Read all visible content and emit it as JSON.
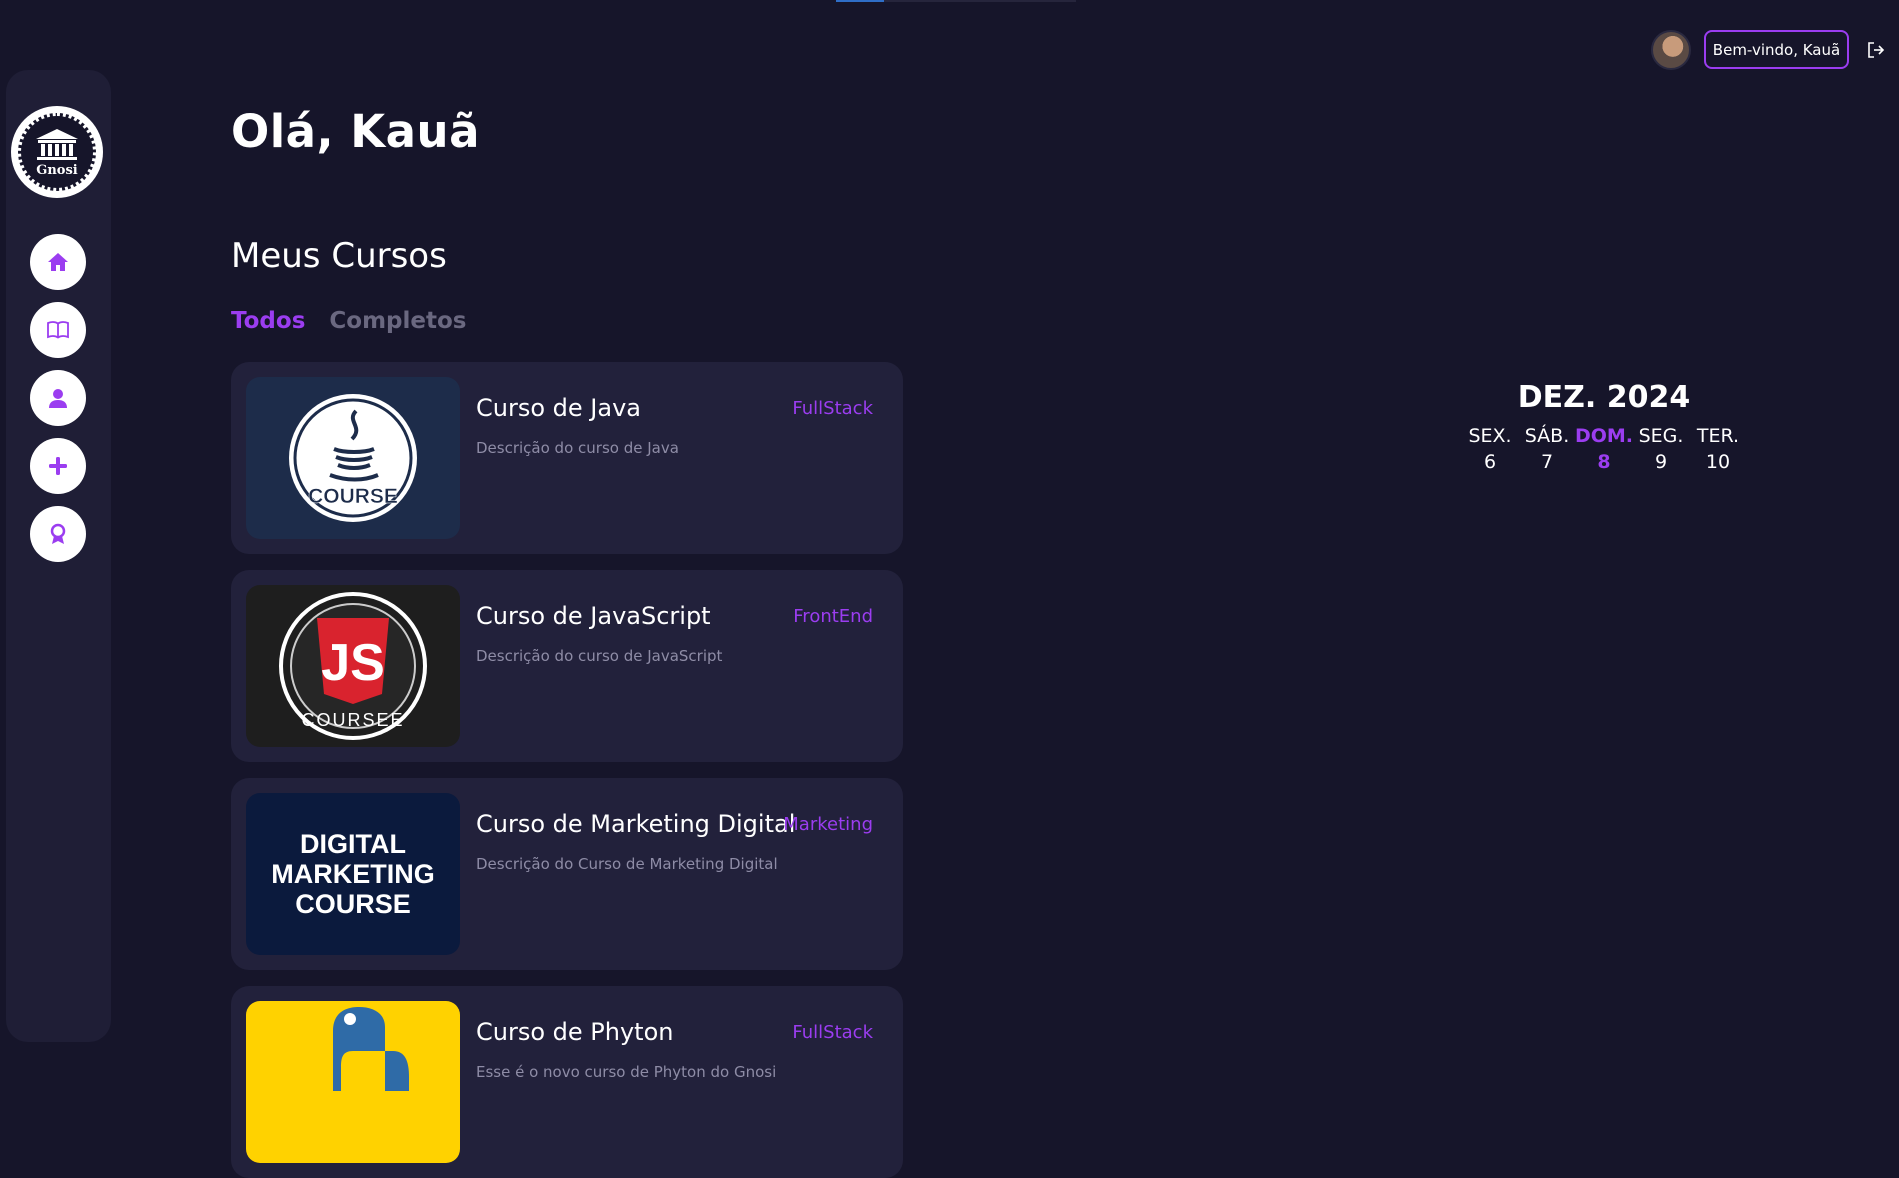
{
  "header": {
    "welcome_label": "Bem-vindo, Kauã"
  },
  "sidebar": {
    "brand": "Gnosi",
    "items": [
      {
        "name": "home"
      },
      {
        "name": "courses"
      },
      {
        "name": "profile"
      },
      {
        "name": "add"
      },
      {
        "name": "certificates"
      }
    ]
  },
  "main": {
    "greeting": "Olá, Kauã",
    "section_title": "Meus Cursos",
    "tabs": [
      {
        "label": "Todos",
        "active": true
      },
      {
        "label": "Completos",
        "active": false
      }
    ],
    "courses": [
      {
        "title": "Curso de Java",
        "tag": "FullStack",
        "description": "Descrição do curso de Java",
        "thumb_text": "COURSE"
      },
      {
        "title": "Curso de JavaScript",
        "tag": "FrontEnd",
        "description": "Descrição do curso de JavaScript",
        "thumb_text": "COURSEE"
      },
      {
        "title": "Curso de Marketing Digital",
        "tag": "Marketing",
        "description": "Descrição do Curso de Marketing Digital",
        "thumb_text": "DIGITAL MARKETING COURSE"
      },
      {
        "title": "Curso de Phyton",
        "tag": "FullStack",
        "description": "Esse é o novo curso de Phyton do Gnosi",
        "thumb_text": ""
      }
    ]
  },
  "calendar": {
    "title": "DEZ. 2024",
    "days": [
      {
        "dow": "SEX.",
        "num": "6"
      },
      {
        "dow": "SÁB.",
        "num": "7"
      },
      {
        "dow": "DOM.",
        "num": "8",
        "today": true
      },
      {
        "dow": "SEG.",
        "num": "9"
      },
      {
        "dow": "TER.",
        "num": "10"
      }
    ]
  },
  "colors": {
    "background": "#16152a",
    "card": "#22213b",
    "accent": "#9b3df0"
  }
}
